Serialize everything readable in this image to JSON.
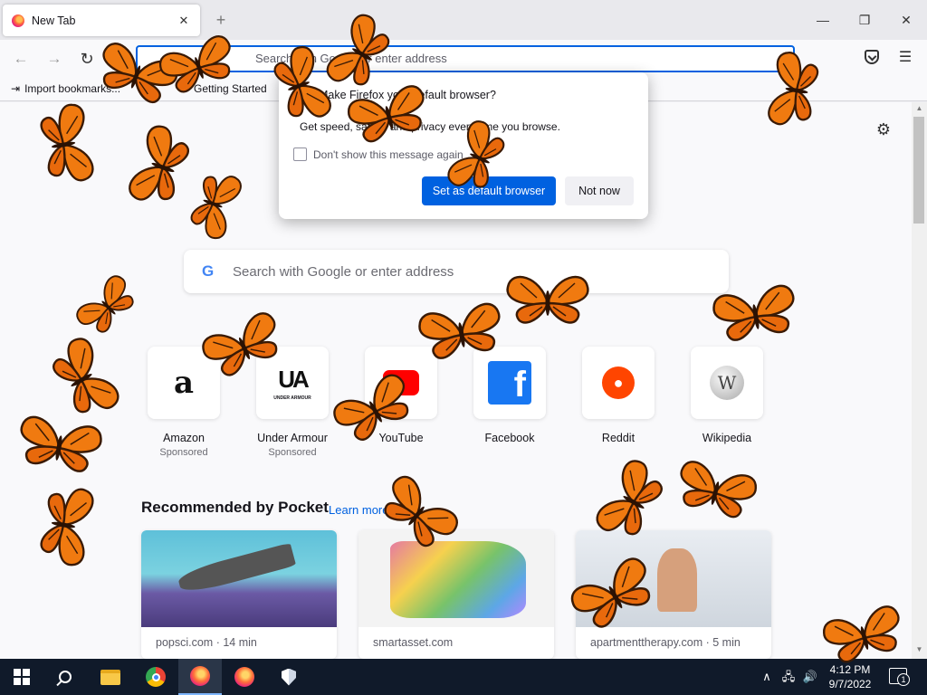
{
  "tab": {
    "title": "New Tab",
    "close": "✕",
    "new_tab": "+"
  },
  "window": {
    "minimize": "—",
    "maximize": "❐",
    "close": "✕"
  },
  "nav": {
    "back": "←",
    "forward": "→",
    "reload": "↻",
    "url_placeholder": "Search with Google or enter address",
    "menu": "☰"
  },
  "bookmarks": {
    "import": "Import bookmarks...",
    "getting_started": "Getting Started"
  },
  "dialog": {
    "title": "Make Firefox your default browser?",
    "body": "Get speed, safety, and privacy every time you browse.",
    "checkbox": "Don't show this message again",
    "primary": "Set as default browser",
    "secondary": "Not now"
  },
  "search": {
    "logo": "G",
    "placeholder": "Search with Google or enter address"
  },
  "tiles": [
    {
      "title": "Amazon",
      "sub": "Sponsored",
      "icon": "amazon-icon"
    },
    {
      "title": "Under Armour",
      "sub": "Sponsored",
      "icon": "under-armour-icon"
    },
    {
      "title": "YouTube",
      "sub": "",
      "icon": "youtube-icon"
    },
    {
      "title": "Facebook",
      "sub": "",
      "icon": "facebook-icon"
    },
    {
      "title": "Reddit",
      "sub": "",
      "icon": "reddit-icon"
    },
    {
      "title": "Wikipedia",
      "sub": "",
      "icon": "wikipedia-icon"
    }
  ],
  "tile_glyphs": {
    "amazon": "a",
    "under_armour": "UA",
    "under_armour_caption": "UNDER ARMOUR",
    "facebook": "f",
    "reddit": "●",
    "wikipedia": "W"
  },
  "pocket": {
    "heading": "Recommended by Pocket",
    "learn": "Learn more",
    "cards": [
      {
        "source": "popsci.com · 14 min"
      },
      {
        "source": "smartasset.com"
      },
      {
        "source": "apartmenttherapy.com · 5 min"
      }
    ]
  },
  "taskbar": {
    "time": "4:12 PM",
    "date": "9/7/2022",
    "notification_count": "1",
    "tray_chevron": "∧",
    "tray_network": "🖧",
    "tray_volume": "🔊"
  },
  "colors": {
    "accent": "#0061e0",
    "taskbar": "#101a2a",
    "butterfly": "#f07a10"
  }
}
